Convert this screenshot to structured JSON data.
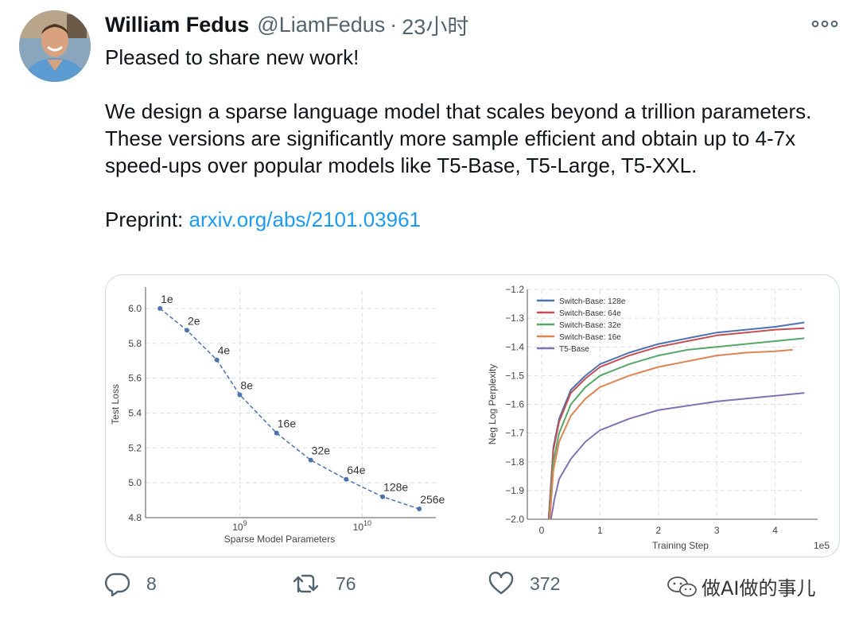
{
  "author": {
    "name": "William Fedus",
    "handle": "@LiamFedus",
    "time": "23小时"
  },
  "tweet": {
    "para1": "Pleased to share new work!",
    "para2": "We design a sparse language model that scales beyond a trillion parameters. These versions are significantly more sample efficient and obtain up to 4-7x speed-ups over popular models like T5-Base, T5-Large, T5-XXL.",
    "preprint_label": "Preprint:",
    "link": "arxiv.org/abs/2101.03961"
  },
  "actions": {
    "replies": "8",
    "retweets": "76",
    "likes": "372"
  },
  "watermark": "做AI做的事儿",
  "colors": {
    "link": "#1d9bf0",
    "muted": "#536471",
    "chart_blue": "#4c72b0",
    "chart_red": "#c44e52",
    "chart_green": "#55a868",
    "chart_orange": "#dd8452",
    "chart_purple": "#8172b3"
  },
  "icons": [
    "more-icon",
    "reply-icon",
    "retweet-icon",
    "like-icon",
    "watermark-logo-icon"
  ],
  "chart_data": [
    {
      "type": "line",
      "xlabel": "Sparse Model Parameters",
      "ylabel": "Test Loss",
      "x_scale": "log",
      "ylim": [
        4.8,
        6.1
      ],
      "y_ticks": [
        "6.0",
        "5.8",
        "5.6",
        "5.4",
        "5.2",
        "5.0",
        "4.8"
      ],
      "x_tick_base": "10",
      "x_tick_exps": [
        "9",
        "10"
      ],
      "grid": true,
      "points": [
        {
          "label": "1e",
          "x": 223000000,
          "y": 6.0
        },
        {
          "label": "2e",
          "x": 370000000,
          "y": 5.875
        },
        {
          "label": "4e",
          "x": 650000000,
          "y": 5.705
        },
        {
          "label": "8e",
          "x": 1000000000,
          "y": 5.505
        },
        {
          "label": "16e",
          "x": 2000000000,
          "y": 5.285
        },
        {
          "label": "32e",
          "x": 3800000000,
          "y": 5.13
        },
        {
          "label": "64e",
          "x": 7400000000,
          "y": 5.02
        },
        {
          "label": "128e",
          "x": 14700000000,
          "y": 4.92
        },
        {
          "label": "256e",
          "x": 29300000000,
          "y": 4.85
        }
      ]
    },
    {
      "type": "line",
      "xlabel": "Training Step",
      "ylabel": "Neg Log Perplexity",
      "x_multiplier_label": "1e5",
      "xlim": [
        0,
        4.5
      ],
      "ylim": [
        -2.0,
        -1.2
      ],
      "x_ticks": [
        "0",
        "1",
        "2",
        "3",
        "4"
      ],
      "y_ticks": [
        "-1.2",
        "-1.3",
        "-1.4",
        "-1.5",
        "-1.6",
        "-1.7",
        "-1.8",
        "-1.9",
        "-2.0"
      ],
      "grid": true,
      "legend": "top-left",
      "series": [
        {
          "name": "Switch-Base: 128e",
          "color": "#4c72b0",
          "x": [
            0.12,
            0.2,
            0.3,
            0.5,
            0.75,
            1.0,
            1.5,
            2.0,
            2.5,
            3.0,
            3.5,
            4.0,
            4.5
          ],
          "y": [
            -2.0,
            -1.75,
            -1.65,
            -1.55,
            -1.5,
            -1.46,
            -1.42,
            -1.39,
            -1.37,
            -1.35,
            -1.34,
            -1.33,
            -1.315
          ]
        },
        {
          "name": "Switch-Base: 64e",
          "color": "#c44e52",
          "x": [
            0.12,
            0.2,
            0.3,
            0.5,
            0.75,
            1.0,
            1.5,
            2.0,
            2.5,
            3.0,
            3.5,
            4.0,
            4.5
          ],
          "y": [
            -2.0,
            -1.76,
            -1.66,
            -1.56,
            -1.51,
            -1.47,
            -1.43,
            -1.4,
            -1.38,
            -1.36,
            -1.35,
            -1.34,
            -1.335
          ]
        },
        {
          "name": "Switch-Base: 32e",
          "color": "#55a868",
          "x": [
            0.13,
            0.2,
            0.3,
            0.5,
            0.75,
            1.0,
            1.5,
            2.0,
            2.5,
            3.0,
            3.5,
            4.0,
            4.5
          ],
          "y": [
            -2.0,
            -1.8,
            -1.7,
            -1.6,
            -1.54,
            -1.5,
            -1.46,
            -1.43,
            -1.41,
            -1.4,
            -1.39,
            -1.38,
            -1.37
          ]
        },
        {
          "name": "Switch-Base: 16e",
          "color": "#dd8452",
          "x": [
            0.14,
            0.2,
            0.3,
            0.5,
            0.75,
            1.0,
            1.5,
            2.0,
            2.5,
            3.0,
            3.5,
            4.0,
            4.3
          ],
          "y": [
            -2.0,
            -1.83,
            -1.73,
            -1.64,
            -1.58,
            -1.54,
            -1.5,
            -1.47,
            -1.45,
            -1.43,
            -1.42,
            -1.415,
            -1.41
          ]
        },
        {
          "name": "T5-Base",
          "color": "#8172b3",
          "x": [
            0.16,
            0.22,
            0.3,
            0.5,
            0.75,
            1.0,
            1.5,
            2.0,
            2.5,
            3.0,
            3.5,
            4.0,
            4.5
          ],
          "y": [
            -2.0,
            -1.93,
            -1.86,
            -1.79,
            -1.73,
            -1.69,
            -1.65,
            -1.62,
            -1.605,
            -1.59,
            -1.58,
            -1.57,
            -1.56
          ]
        }
      ]
    }
  ]
}
